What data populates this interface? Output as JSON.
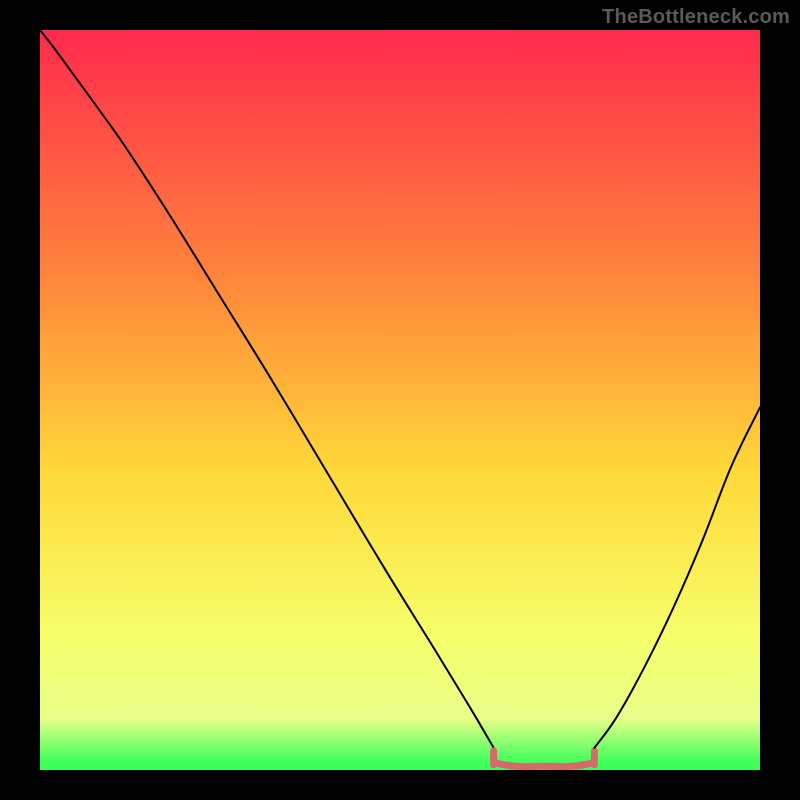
{
  "watermark": "TheBottleneck.com",
  "chart_data": {
    "type": "line",
    "title": "",
    "xlabel": "",
    "ylabel": "",
    "xlim": [
      0,
      100
    ],
    "ylim": [
      0,
      100
    ],
    "grid": false,
    "legend": false,
    "background_gradient": {
      "stops": [
        {
          "offset": 0.0,
          "color": "#ff2a4d"
        },
        {
          "offset": 0.35,
          "color": "#ff8a3a"
        },
        {
          "offset": 0.6,
          "color": "#ffd93a"
        },
        {
          "offset": 0.82,
          "color": "#f6ff6a"
        },
        {
          "offset": 0.93,
          "color": "#eaff8a"
        },
        {
          "offset": 0.99,
          "color": "#3cff5a"
        }
      ]
    },
    "series": [
      {
        "name": "left-curve",
        "color": "#000000",
        "points": [
          {
            "x": 0.0,
            "y": 100.0
          },
          {
            "x": 2.0,
            "y": 97.5
          },
          {
            "x": 5.0,
            "y": 93.5
          },
          {
            "x": 8.0,
            "y": 89.5
          },
          {
            "x": 12.0,
            "y": 84.0
          },
          {
            "x": 18.0,
            "y": 75.0
          },
          {
            "x": 25.0,
            "y": 64.0
          },
          {
            "x": 32.0,
            "y": 53.0
          },
          {
            "x": 40.0,
            "y": 40.0
          },
          {
            "x": 48.0,
            "y": 27.0
          },
          {
            "x": 55.0,
            "y": 16.0
          },
          {
            "x": 60.0,
            "y": 8.0
          },
          {
            "x": 63.0,
            "y": 3.0
          }
        ]
      },
      {
        "name": "flat-segment",
        "color": "#d66a6a",
        "thick": true,
        "points": [
          {
            "x": 63.0,
            "y": 1.0
          },
          {
            "x": 66.0,
            "y": 0.5
          },
          {
            "x": 70.0,
            "y": 0.5
          },
          {
            "x": 74.0,
            "y": 0.5
          },
          {
            "x": 77.0,
            "y": 1.0
          }
        ],
        "end_ticks": [
          {
            "x": 63.0,
            "y": 1.5
          },
          {
            "x": 77.0,
            "y": 1.5
          }
        ]
      },
      {
        "name": "right-curve",
        "color": "#000000",
        "points": [
          {
            "x": 77.0,
            "y": 3.0
          },
          {
            "x": 80.0,
            "y": 7.0
          },
          {
            "x": 84.0,
            "y": 14.0
          },
          {
            "x": 88.0,
            "y": 22.0
          },
          {
            "x": 92.0,
            "y": 31.0
          },
          {
            "x": 96.0,
            "y": 41.0
          },
          {
            "x": 100.0,
            "y": 49.0
          }
        ]
      }
    ]
  }
}
